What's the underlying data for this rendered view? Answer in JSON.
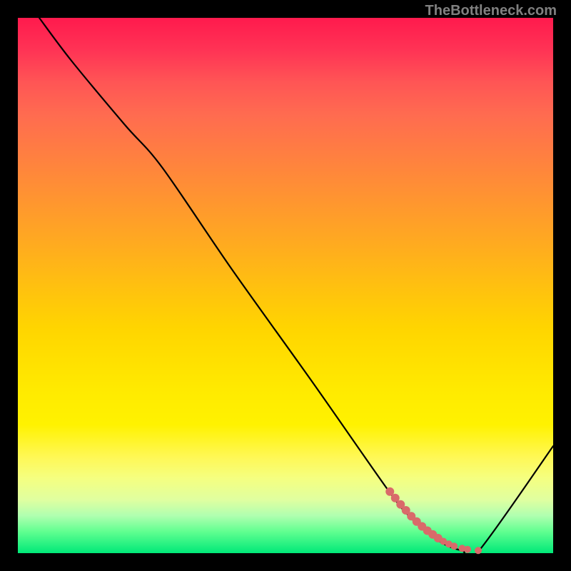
{
  "watermark": "TheBottleneck.com",
  "chart_data": {
    "type": "line",
    "title": "",
    "xlabel": "",
    "ylabel": "",
    "xlim": [
      0,
      100
    ],
    "ylim": [
      0,
      100
    ],
    "series": [
      {
        "name": "bottleneck-curve",
        "x": [
          4,
          10,
          20,
          27,
          40,
          55,
          69,
          73,
          77,
          80,
          83,
          86,
          100
        ],
        "values": [
          100,
          92,
          80,
          72,
          53,
          32,
          12,
          7,
          3.5,
          1.5,
          0.5,
          0.3,
          20
        ]
      }
    ],
    "markers": {
      "name": "highlight-dots",
      "color": "#d96a6a",
      "x": [
        69.5,
        70.5,
        71.5,
        72.5,
        73.5,
        74.5,
        75.5,
        76.5,
        77.5,
        78.5,
        79.5,
        80.5,
        81.5,
        83,
        84,
        86
      ],
      "values": [
        11.5,
        10.3,
        9.1,
        8.0,
        6.9,
        5.9,
        5.0,
        4.2,
        3.5,
        2.8,
        2.2,
        1.7,
        1.3,
        0.9,
        0.7,
        0.5
      ]
    },
    "gradient_stops": [
      {
        "pct": 0,
        "color": "#ff1a4d"
      },
      {
        "pct": 50,
        "color": "#ffd500"
      },
      {
        "pct": 90,
        "color": "#e0ffa0"
      },
      {
        "pct": 100,
        "color": "#00e878"
      }
    ]
  }
}
